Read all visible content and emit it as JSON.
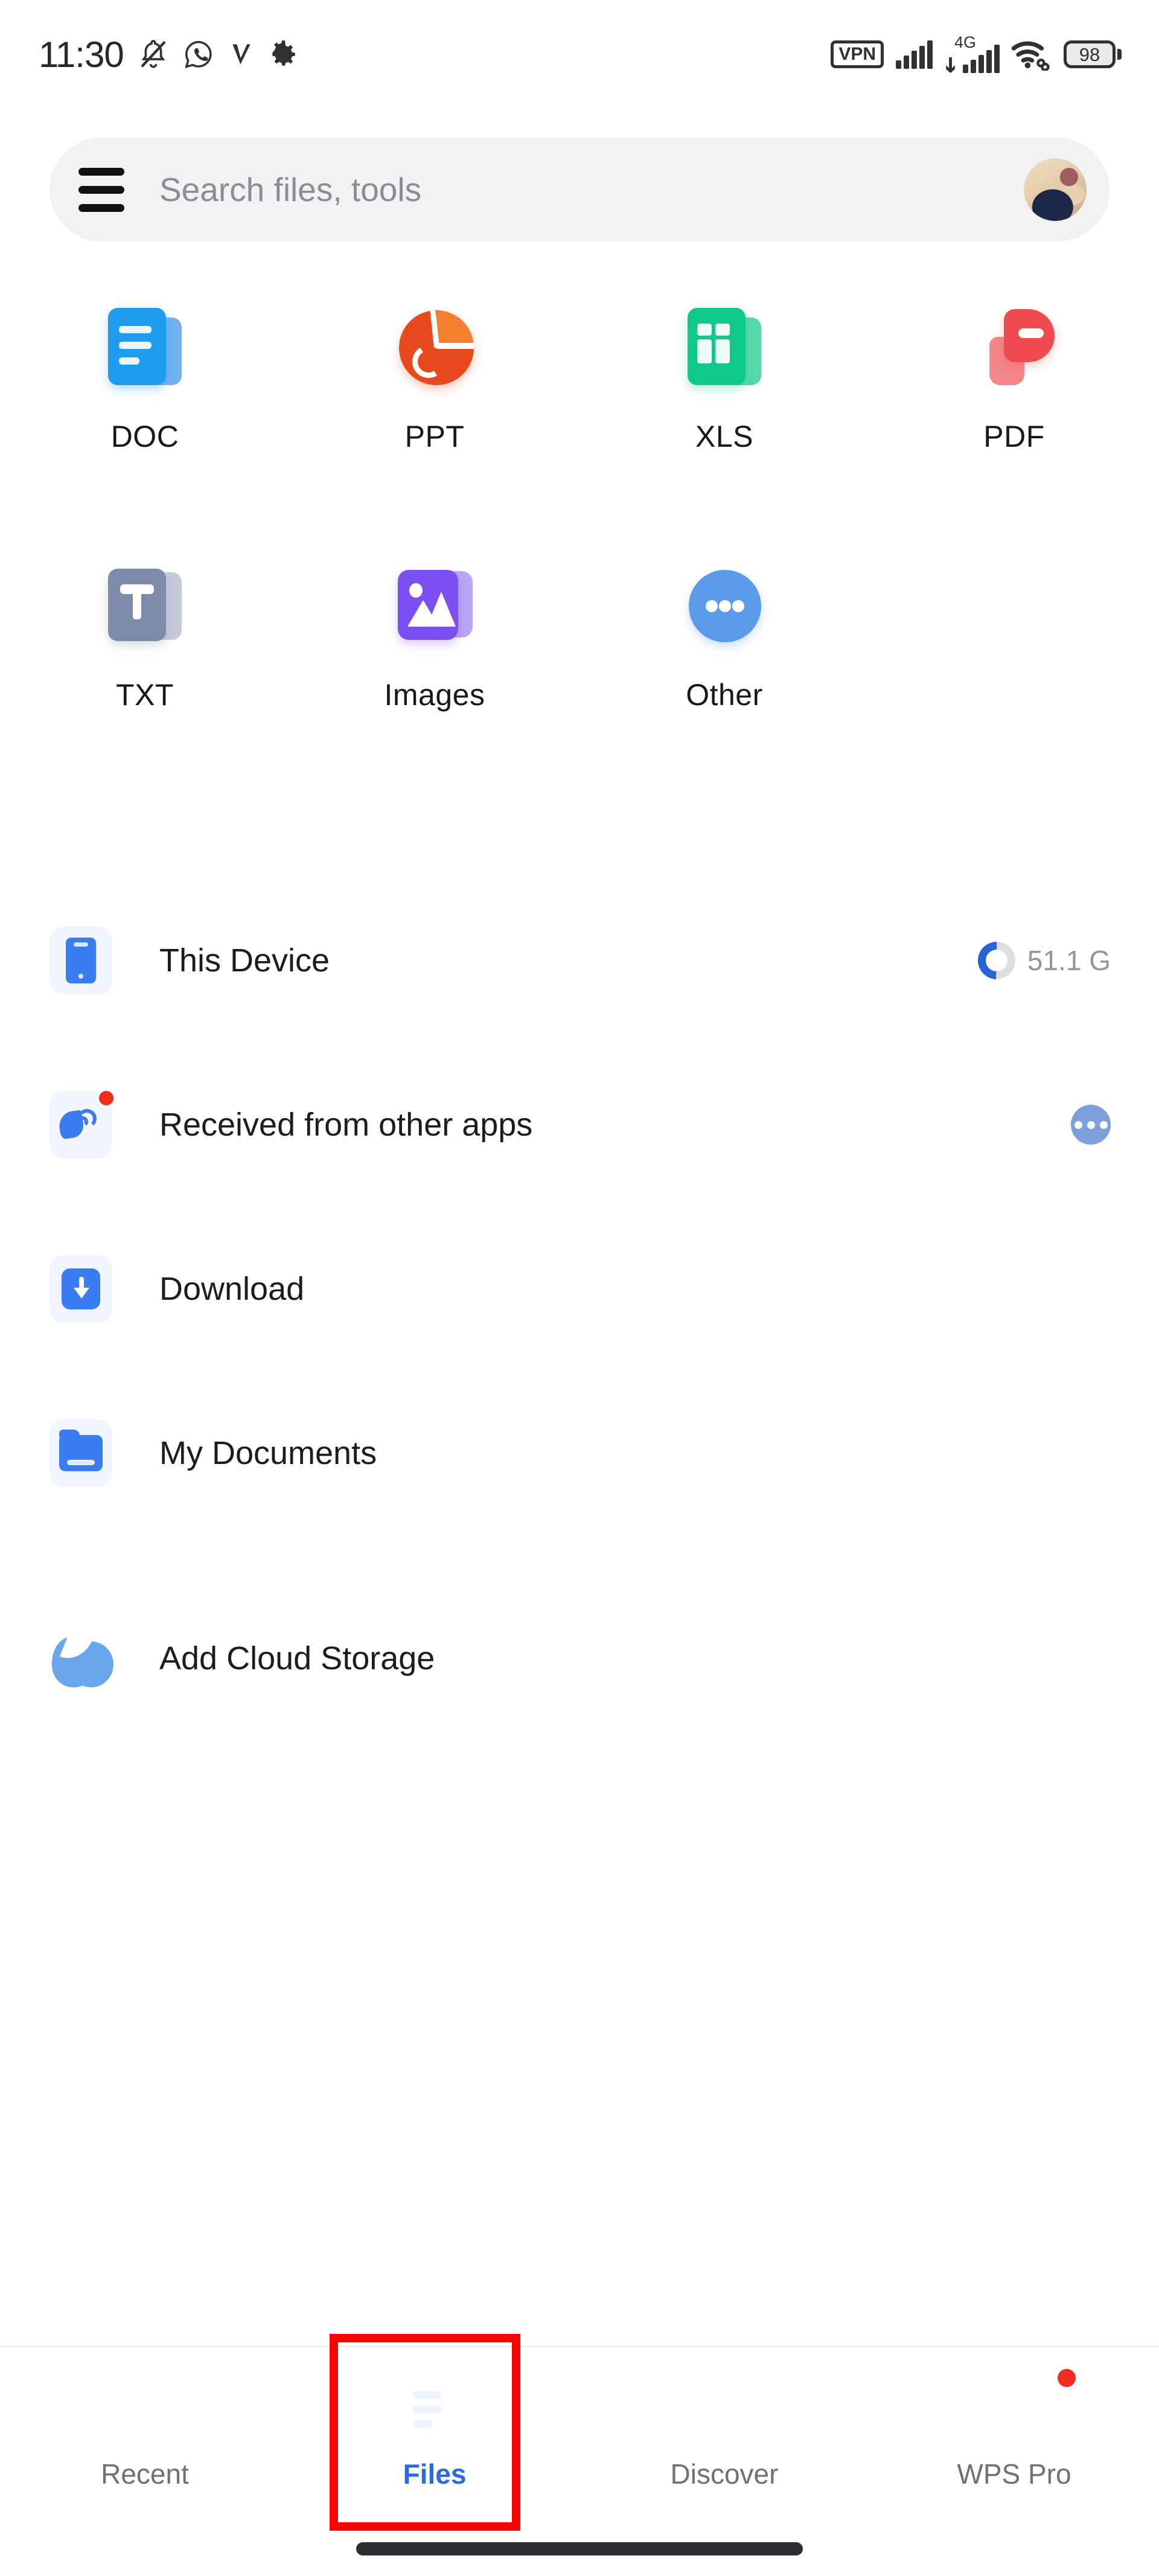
{
  "status_bar": {
    "time": "11:30",
    "left_icons": [
      "bell-muted-icon",
      "whatsapp-icon",
      "vpn-check-icon",
      "gear-icon"
    ],
    "vpn_label": "VPN",
    "network_label": "4G",
    "battery_level": "98",
    "right_icons": [
      "vpn-badge-icon",
      "signal-bars-icon",
      "signal-4g-icon",
      "wifi-link-icon",
      "battery-icon"
    ]
  },
  "search": {
    "placeholder": "Search files, tools",
    "menu_icon": "hamburger-menu-icon",
    "avatar_icon": "user-avatar"
  },
  "file_types": [
    {
      "label": "DOC",
      "icon": "doc-file-icon",
      "color": "#1f9bf0"
    },
    {
      "label": "PPT",
      "icon": "ppt-file-icon",
      "color": "#e8491f"
    },
    {
      "label": "XLS",
      "icon": "xls-file-icon",
      "color": "#10c887"
    },
    {
      "label": "PDF",
      "icon": "pdf-file-icon",
      "color": "#ef4a50"
    },
    {
      "label": "TXT",
      "icon": "txt-file-icon",
      "color": "#7d8aa8"
    },
    {
      "label": "Images",
      "icon": "images-file-icon",
      "color": "#7d4ff0"
    },
    {
      "label": "Other",
      "icon": "other-file-icon",
      "color": "#5b9bea"
    }
  ],
  "storage_list": [
    {
      "label": "This Device",
      "icon": "phone-device-icon",
      "trailing_type": "storage-ring",
      "trailing_value": "51.1 G",
      "has_badge": false
    },
    {
      "label": "Received from other apps",
      "icon": "received-apps-icon",
      "trailing_type": "more-button",
      "trailing_value": "",
      "has_badge": true
    },
    {
      "label": "Download",
      "icon": "download-icon",
      "trailing_type": "none",
      "trailing_value": "",
      "has_badge": false
    },
    {
      "label": "My Documents",
      "icon": "folder-icon",
      "trailing_type": "none",
      "trailing_value": "",
      "has_badge": false
    }
  ],
  "cloud": {
    "label": "Add Cloud Storage",
    "icon": "cloud-icon"
  },
  "bottom_nav": {
    "items": [
      {
        "label": "Recent",
        "icon": "recent-icon",
        "active": false,
        "has_dot": false
      },
      {
        "label": "Files",
        "icon": "files-icon",
        "active": true,
        "has_dot": false
      },
      {
        "label": "Discover",
        "icon": "compass-icon",
        "active": false,
        "has_dot": false
      },
      {
        "label": "WPS Pro",
        "icon": "wps-pro-icon",
        "active": false,
        "has_dot": true
      }
    ],
    "active_color": "#2a6ae0",
    "inactive_color": "#6f7175"
  },
  "annotation": {
    "highlight_color": "#ff0000",
    "target": "files-tab"
  }
}
